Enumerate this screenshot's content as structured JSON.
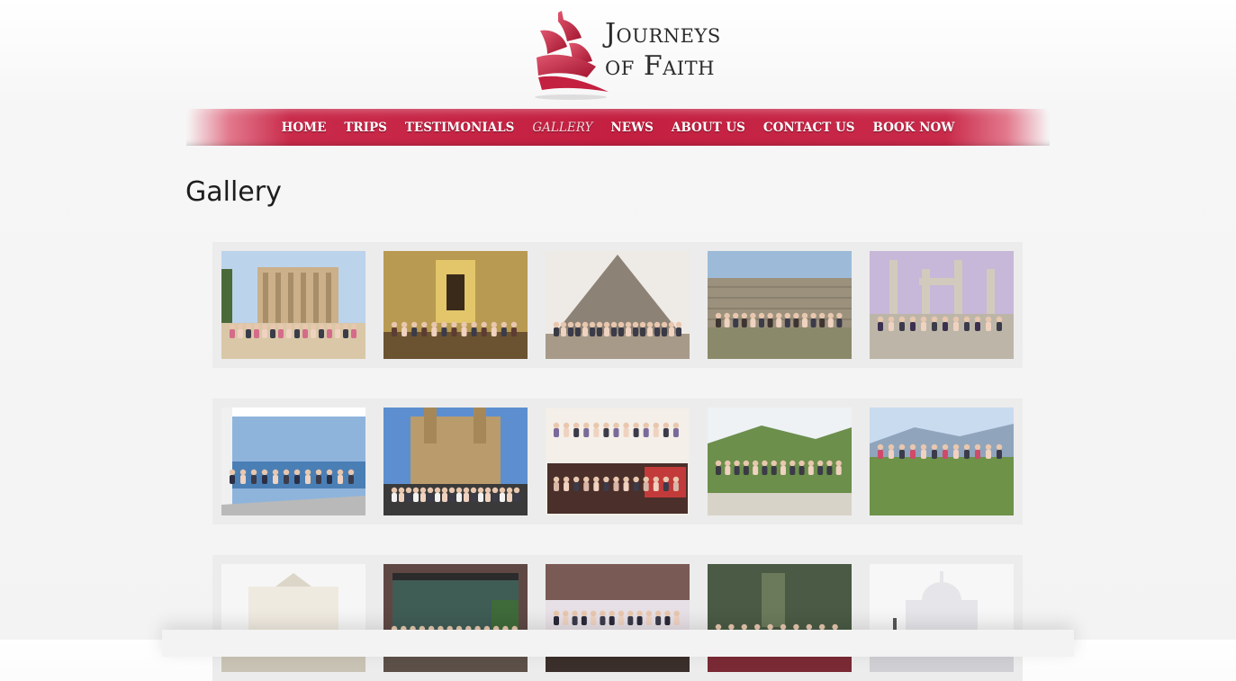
{
  "logo": {
    "line1": "Journeys",
    "line2": "of Faith",
    "colors": {
      "sail": "#c4203f",
      "text": "#2b2b2b"
    }
  },
  "nav": {
    "items": [
      {
        "label": "HOME",
        "active": false
      },
      {
        "label": "TRIPS",
        "active": false
      },
      {
        "label": "TESTIMONIALS",
        "active": false
      },
      {
        "label": "GALLERY",
        "active": true
      },
      {
        "label": "NEWS",
        "active": false
      },
      {
        "label": "ABOUT US",
        "active": false
      },
      {
        "label": "CONTACT US",
        "active": false
      },
      {
        "label": "BOOK NOW",
        "active": false
      }
    ],
    "colors": {
      "bar": "#c41f40",
      "text": "#ffffff"
    }
  },
  "page": {
    "title": "Gallery"
  },
  "gallery": {
    "rows": [
      [
        "ephesus-library-group-photo",
        "church-altar-group-photo",
        "pyramid-group-photo",
        "stone-wall-ruins-group-photo",
        "temple-columns-group-photo"
      ],
      [
        "boat-deck-group-photo",
        "cathedral-facade-crowd-photo",
        "restaurant-collage-group-photo",
        "hillside-village-group-photo",
        "jumping-group-mountain-photo"
      ],
      [
        "white-church-plaza-group-photo",
        "building-entrance-group-photo",
        "dinner-party-group-photo",
        "statue-flowers-group-photo",
        "sacre-coeur-basilica-photo"
      ]
    ]
  }
}
